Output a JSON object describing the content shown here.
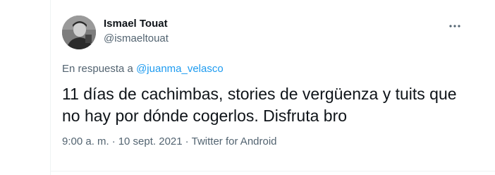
{
  "author": {
    "name": "Ismael Touat",
    "handle": "@ismaeltouat"
  },
  "reply": {
    "prefix": "En respuesta a ",
    "mention": "@juanma_velasco"
  },
  "tweet": {
    "text": "11 días de cachimbas, stories de vergüenza y tuits que no hay por dónde cogerlos. Disfruta bro"
  },
  "meta": {
    "time": "9:00 a. m.",
    "separator": "·",
    "date": "10 sept. 2021",
    "source": "Twitter for Android"
  },
  "icons": {
    "more": "more-horizontal-icon"
  },
  "colors": {
    "text_primary": "#0f1419",
    "text_secondary": "#536471",
    "link": "#1d9bf0",
    "divider": "#eff3f4"
  }
}
